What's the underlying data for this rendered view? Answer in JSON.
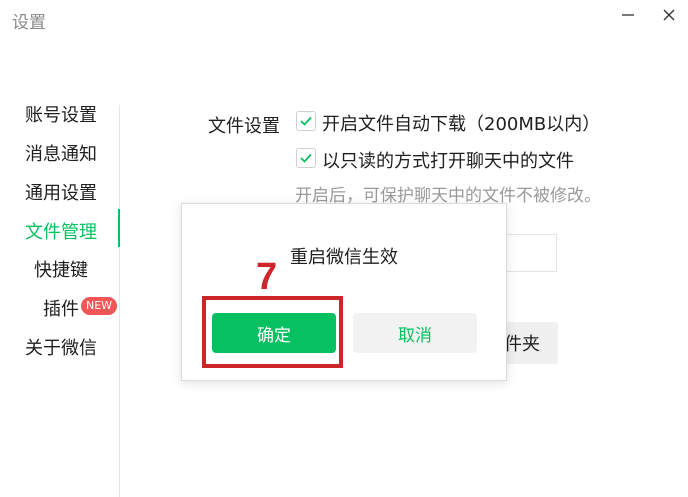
{
  "window": {
    "title": "设置",
    "minimize_glyph": "minimize-icon",
    "close_glyph": "close-icon"
  },
  "sidebar": {
    "items": [
      {
        "label": "账号设置"
      },
      {
        "label": "消息通知"
      },
      {
        "label": "通用设置"
      },
      {
        "label": "文件管理",
        "active": true
      },
      {
        "label": "快捷键"
      },
      {
        "label": "插件",
        "badge": "NEW"
      },
      {
        "label": "关于微信"
      }
    ]
  },
  "file_settings": {
    "section_label": "文件设置",
    "options": [
      {
        "label": "开启文件自动下载（200MB以内）",
        "checked": true
      },
      {
        "label": "以只读的方式打开聊天中的文件",
        "checked": true
      }
    ],
    "hint": "开启后，可保护聊天中的文件不被修改。",
    "open_folder_button": "件夹"
  },
  "dialog": {
    "message": "重启微信生效",
    "ok_label": "确定",
    "cancel_label": "取消"
  },
  "annotation": {
    "step": "7"
  },
  "colors": {
    "accent": "#07c160",
    "annotation": "#d0242b",
    "badge": "#f25555"
  }
}
